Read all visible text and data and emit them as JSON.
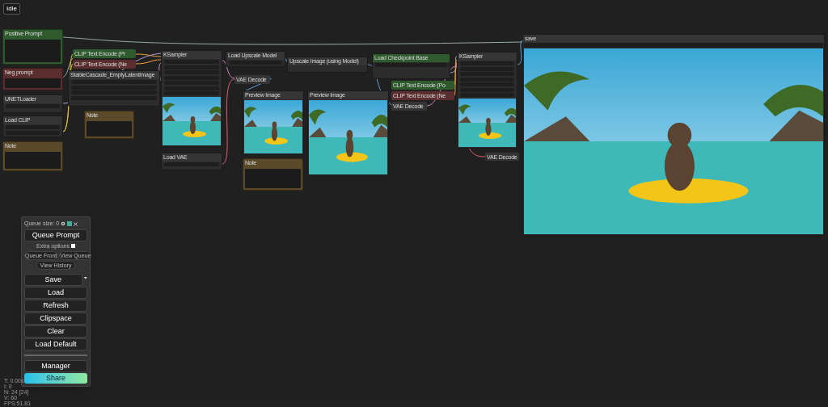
{
  "status": "Idle",
  "nodes": [
    {
      "kind": "text",
      "title": "Positive Prompt",
      "color": "#2e5a2e"
    },
    {
      "kind": "text",
      "title": "Neg prompt",
      "color": "#5a2e2e"
    },
    {
      "kind": "widgets",
      "title": "UNETLoader",
      "color": "#353535"
    },
    {
      "kind": "widgets",
      "title": "Load CLIP",
      "color": "#353535"
    },
    {
      "kind": "note",
      "title": "Note",
      "color": "#5a4a2a"
    },
    {
      "kind": "collapsed",
      "title": "CLIP Text Encode (Pr",
      "color": "#2e5a2e"
    },
    {
      "kind": "collapsed",
      "title": "CLIP Text Encode (Ne",
      "color": "#5a2e2e"
    },
    {
      "kind": "widgets",
      "title": "StableCascade_EmptyLatentImage",
      "color": "#353535"
    },
    {
      "kind": "note",
      "title": "Note",
      "color": "#5a4a2a"
    },
    {
      "kind": "preview",
      "title": "KSampler",
      "color": "#353535"
    },
    {
      "kind": "widgets",
      "title": "Load VAE",
      "color": "#353535"
    },
    {
      "kind": "widgets",
      "title": "Load Upscale Model",
      "color": "#353535"
    },
    {
      "kind": "collapsed",
      "title": "VAE Decode",
      "color": "#353535"
    },
    {
      "kind": "preview",
      "title": "Preview Image",
      "color": "#353535"
    },
    {
      "kind": "note",
      "title": "Note",
      "color": "#5a4a2a"
    },
    {
      "kind": "widgets",
      "title": "Upscale Image (using Model)",
      "color": "#353535"
    },
    {
      "kind": "preview",
      "title": "Preview Image",
      "color": "#353535"
    },
    {
      "kind": "widgets",
      "title": "Load Checkpoint Base",
      "color": "#2e5a2e"
    },
    {
      "kind": "collapsed",
      "title": "CLIP Text Encode (Po",
      "color": "#2e5a2e"
    },
    {
      "kind": "collapsed",
      "title": "CLIP Text Encode (Ne",
      "color": "#5a2e2e"
    },
    {
      "kind": "collapsed",
      "title": "VAE Decode",
      "color": "#353535"
    },
    {
      "kind": "preview",
      "title": "KSampler",
      "color": "#353535"
    },
    {
      "kind": "collapsed",
      "title": "VAE Decode",
      "color": "#353535"
    },
    {
      "kind": "save",
      "title": "save",
      "color": "#353535"
    }
  ],
  "queue": {
    "title": "Queue size: 0",
    "queue_button": "Queue Prompt",
    "extra_options": "Extra options",
    "extra_checked": false,
    "small_buttons": [
      "Queue Front",
      "View Queue"
    ],
    "history_button": "View History",
    "save_button": "Save",
    "buttons": [
      "Load",
      "Refresh",
      "Clipspace",
      "Clear",
      "Load Default"
    ],
    "manager_button": "Manager",
    "share_button": "Share"
  },
  "stats": [
    "T: 0.00s",
    "I: 0",
    "N: 24 [24]",
    "V: 60",
    "FPS:51.81"
  ]
}
